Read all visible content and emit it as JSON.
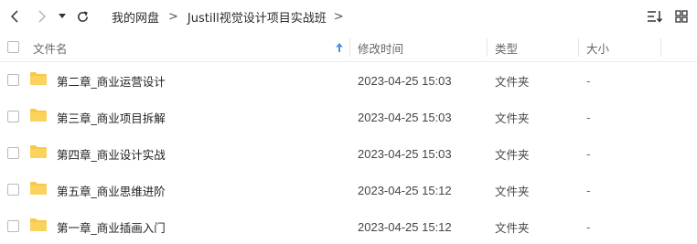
{
  "toolbar": {
    "back_icon": "chevron-left-icon",
    "forward_icon": "chevron-right-icon",
    "history_icon": "caret-down-icon",
    "refresh_icon": "refresh-icon",
    "breadcrumb": {
      "root": "我的网盘",
      "separator": ">",
      "current": "Justill视觉设计项目实战班"
    },
    "sort_view_icon": "sort-list-icon",
    "grid_view_icon": "grid-view-icon"
  },
  "columns": {
    "name": "文件名",
    "modified": "修改时间",
    "type": "类型",
    "size": "大小",
    "sort_indicator_icon": "sort-ascending-arrow-icon",
    "sort_color": "#4a90e2"
  },
  "folder_color": "#f7c948",
  "files": [
    {
      "name": "第二章_商业运营设计",
      "modified": "2023-04-25 15:03",
      "type": "文件夹",
      "size": "-"
    },
    {
      "name": "第三章_商业项目拆解",
      "modified": "2023-04-25 15:03",
      "type": "文件夹",
      "size": "-"
    },
    {
      "name": "第四章_商业设计实战",
      "modified": "2023-04-25 15:03",
      "type": "文件夹",
      "size": "-"
    },
    {
      "name": "第五章_商业思维进阶",
      "modified": "2023-04-25 15:12",
      "type": "文件夹",
      "size": "-"
    },
    {
      "name": "第一章_商业插画入门",
      "modified": "2023-04-25 15:12",
      "type": "文件夹",
      "size": "-"
    }
  ]
}
